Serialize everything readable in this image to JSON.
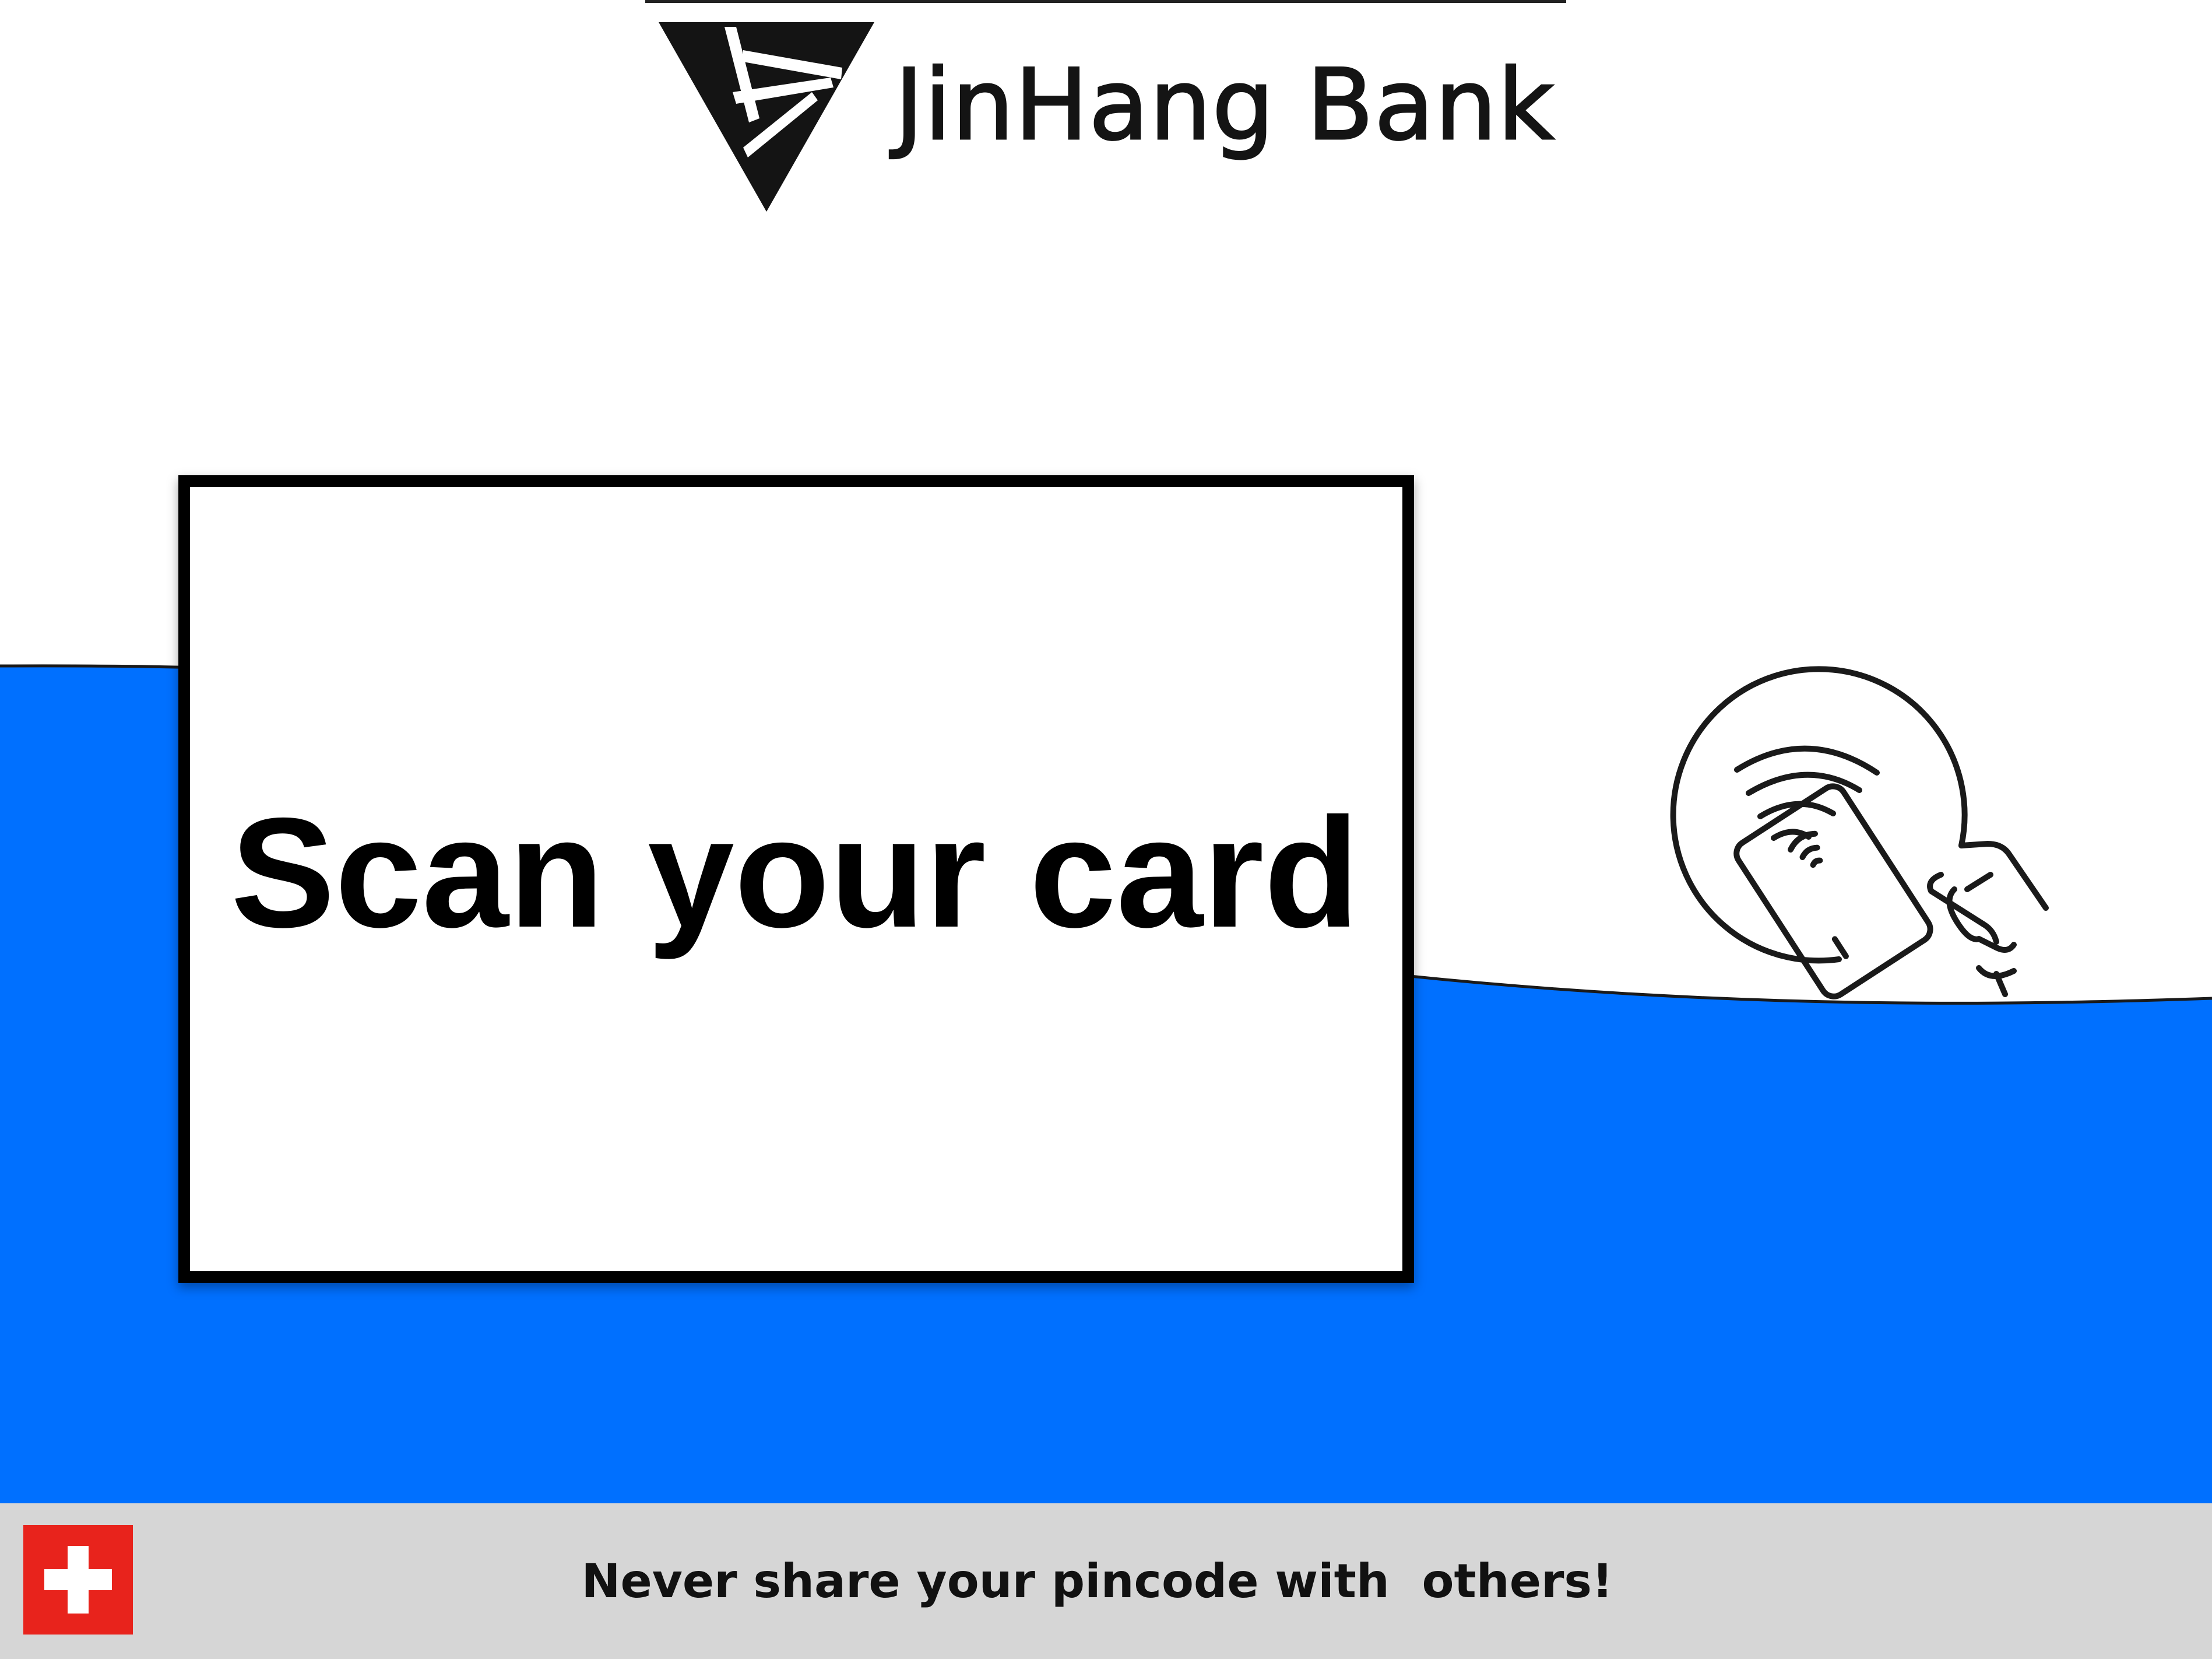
{
  "brand": {
    "name": "JinHang Bank",
    "logo_icon": "triangle-v-logo-icon"
  },
  "main": {
    "message": "Scan your card",
    "nfc_icon": "contactless-card-tap-icon"
  },
  "footer": {
    "warning": "Never share your pincode with  others!",
    "flag_icon": "swiss-flag-icon"
  },
  "colors": {
    "accent_blue": "#0070ff",
    "background": "#ffffff",
    "footer_gray": "#d6d6d6",
    "flag_red": "#e8231c",
    "text": "#000000"
  }
}
